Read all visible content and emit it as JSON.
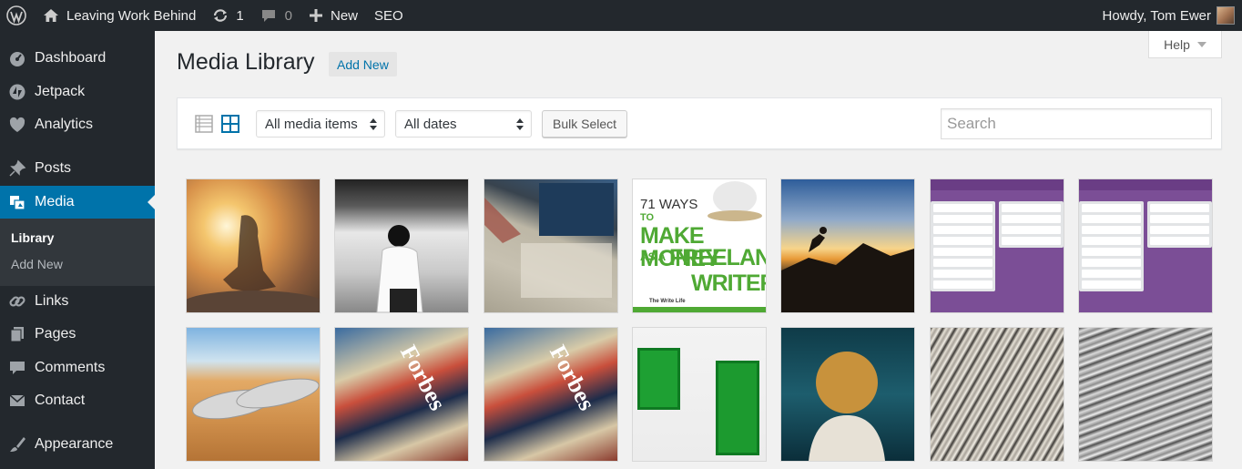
{
  "admin_bar": {
    "site_name": "Leaving Work Behind",
    "updates_count": "1",
    "comments_count": "0",
    "new_label": "New",
    "seo_label": "SEO",
    "greeting": "Howdy, Tom Ewer"
  },
  "sidebar": {
    "items": [
      {
        "label": "Dashboard",
        "icon": "dashboard-icon"
      },
      {
        "label": "Jetpack",
        "icon": "jetpack-icon"
      },
      {
        "label": "Analytics",
        "icon": "analytics-icon"
      },
      {
        "label": "Posts",
        "icon": "pin-icon"
      },
      {
        "label": "Media",
        "icon": "media-icon",
        "active": true
      },
      {
        "label": "Links",
        "icon": "link-icon"
      },
      {
        "label": "Pages",
        "icon": "pages-icon"
      },
      {
        "label": "Comments",
        "icon": "comment-icon"
      },
      {
        "label": "Contact",
        "icon": "envelope-icon"
      },
      {
        "label": "Appearance",
        "icon": "brush-icon"
      }
    ],
    "submenu": [
      {
        "label": "Library",
        "current": true
      },
      {
        "label": "Add New"
      }
    ]
  },
  "help": {
    "label": "Help"
  },
  "page": {
    "title": "Media Library",
    "add_new_label": "Add New"
  },
  "toolbar": {
    "media_filter": "All media items",
    "date_filter": "All dates",
    "bulk_select_label": "Bulk Select",
    "search_placeholder": "Search"
  },
  "thumbnails": {
    "freelance": {
      "line1": "71 WAYS",
      "line2": "TO",
      "line3": "MAKE MONEY",
      "line4": "AS A",
      "line5": "FREELANCE",
      "line6": "WRITER",
      "logo": "The Write Life"
    },
    "magazine_brand": "Forbes"
  },
  "colors": {
    "admin_dark": "#23282d",
    "accent": "#0073aa",
    "submenu_bg": "#32373c",
    "trello_purple": "#7b4e96",
    "book_green": "#4fa934"
  }
}
